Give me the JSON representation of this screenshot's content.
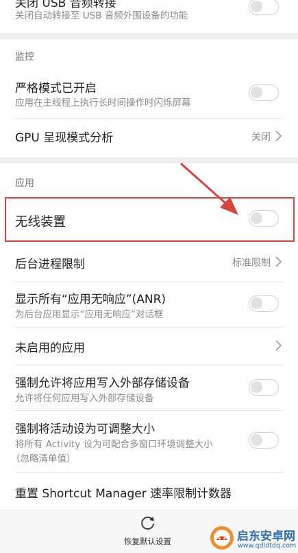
{
  "top_item": {
    "title": "关闭 USB 音频转接",
    "subtitle": "关闭自动转接至 USB 音频外围设备的功能"
  },
  "monitor_section": {
    "header": "监控",
    "strict_mode": {
      "title": "严格模式已开启",
      "subtitle": "应用在主线程上执行长时间操作时闪烁屏幕",
      "enabled": false
    },
    "gpu_profile": {
      "title": "GPU 呈现模式分析",
      "value": "关闭"
    }
  },
  "apps_section": {
    "header": "应用",
    "wireless_device": {
      "title": "无线装置",
      "enabled": false
    },
    "background_limit": {
      "title": "后台进程限制",
      "value": "标准限制"
    },
    "show_anr": {
      "title": "显示所有“应用无响应”(ANR)",
      "subtitle": "为后台应用显示“应用无响应”对话框",
      "enabled": false
    },
    "inactive_apps": {
      "title": "未启用的应用"
    },
    "force_external": {
      "title": "强制允许将应用写入外部存储设备",
      "subtitle": "允许将任何应用写入外部存储设备",
      "enabled": false
    },
    "force_resizable": {
      "title": "强制将活动设为可调整大小",
      "subtitle_line1": "将所有 Activity 设为可配合多窗口环境调整大小",
      "subtitle_line2": "（忽略清单值）",
      "enabled": false
    },
    "reset_shortcut": {
      "title": "重置 Shortcut Manager 速率限制计数器"
    }
  },
  "bottom_bar": {
    "restore_label": "恢复默认设置"
  },
  "watermark": {
    "name": "启东安卓网",
    "url": "www.qdldtdq.com"
  },
  "colors": {
    "highlight": "#d9443c",
    "accent": "#2f6fb5"
  }
}
